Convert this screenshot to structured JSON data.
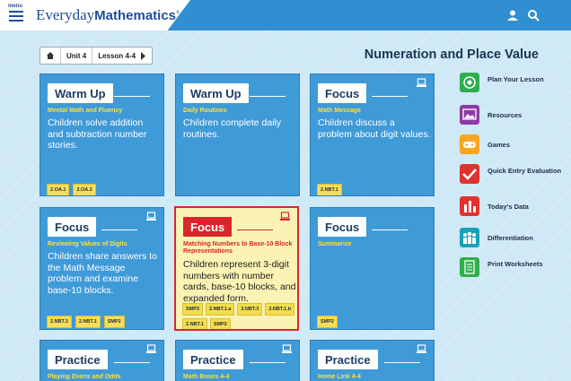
{
  "header": {
    "menu_label": "menu",
    "brand_regular": "Everyday",
    "brand_bold": "Mathematics",
    "brand_mark": "®",
    "icons": [
      "menu-icon",
      "user-icon",
      "search-icon"
    ]
  },
  "breadcrumb": {
    "home_icon": "home-icon",
    "unit": "Unit 4",
    "lesson": "Lesson 4-4",
    "next_icon": "caret-right-icon"
  },
  "page_title": "Numeration and Place Value",
  "colors": {
    "topbar": "#2f8fd0",
    "card": "#3f9ad8",
    "selected_border": "#d9262c",
    "selected_bg": "#fbf3b3",
    "subtitle": "#ffe13a",
    "tag": "#f8dd5a"
  },
  "cards": [
    {
      "heading": "Warm Up",
      "subtitle": "Mental Math and Fluency",
      "description": "Children solve addition and subtraction number stories.",
      "tags": [
        "2.OA.1",
        "2.OA.2"
      ],
      "device_icon": false
    },
    {
      "heading": "Warm Up",
      "subtitle": "Daily Routines",
      "description": "Children complete daily routines.",
      "tags": [],
      "device_icon": false
    },
    {
      "heading": "Focus",
      "subtitle": "Math Message",
      "description": "Children discuss a problem about digit values.",
      "tags": [
        "2.NBT.1"
      ],
      "device_icon": true
    },
    {
      "heading": "Focus",
      "subtitle": "Reviewing Values of Digits",
      "description": "Children share answers to the Math Message problem and examine base-10 blocks.",
      "tags": [
        "2.NBT.3",
        "2.NBT.1",
        "SMP2"
      ],
      "device_icon": true
    },
    {
      "heading": "Focus",
      "subtitle": "Matching Numbers to Base-10 Block Representations",
      "description": "Children represent 3-digit numbers with number cards, base-10 blocks, and expanded form.",
      "tags": [
        "SMP3",
        "2.NBT.1.a",
        "2.NBT.3",
        "2.NBT.1.b",
        "2.NBT.1",
        "SMP2"
      ],
      "device_icon": true,
      "selected": true
    },
    {
      "heading": "Focus",
      "subtitle": "Summarize",
      "description": "",
      "tags": [
        "SMP2"
      ],
      "device_icon": false
    },
    {
      "heading": "Practice",
      "subtitle": "Playing Evens and Odds",
      "subtitle_parts": [
        "Playing ",
        "Evens and Odds"
      ],
      "description": "",
      "tags": [],
      "device_icon": true
    },
    {
      "heading": "Practice",
      "subtitle": "Math Boxes 4-4",
      "description": "",
      "tags": [],
      "device_icon": true
    },
    {
      "heading": "Practice",
      "subtitle": "Home Link 4-4",
      "description": "",
      "tags": [],
      "device_icon": true
    }
  ],
  "side_menu": [
    {
      "label": "Plan Your Lesson",
      "icon": "target-icon",
      "color": "#2fae4e"
    },
    {
      "label": "Resources",
      "icon": "image-icon",
      "color": "#8c3aa3"
    },
    {
      "label": "Games",
      "icon": "gamepad-icon",
      "color": "#f5a623"
    },
    {
      "label": "Quick Entry Evaluation",
      "icon": "checkmark-icon",
      "color": "#e0332f"
    },
    {
      "label": "Today's Data",
      "icon": "bar-chart-icon",
      "color": "#e0332f"
    },
    {
      "label": "Differentiation",
      "icon": "people-icon",
      "color": "#17a2b8"
    },
    {
      "label": "Print Worksheets",
      "icon": "worksheet-icon",
      "color": "#2fae4e"
    }
  ]
}
